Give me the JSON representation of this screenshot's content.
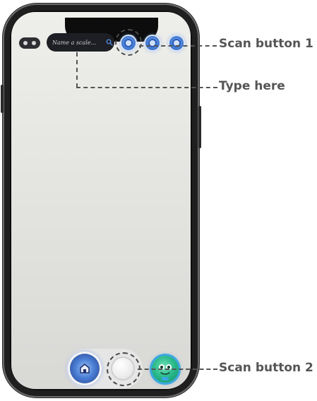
{
  "screen": {
    "search": {
      "placeholder": "Name a scale..."
    }
  },
  "callouts": {
    "scan_button_1": "Scan button 1",
    "type_here": "Type here",
    "scan_button_2": "Scan button 2"
  },
  "icons": {
    "search": "search-icon",
    "home": "home-icon",
    "mascot": "mascot-icon"
  },
  "colors": {
    "accent_blue": "#4f86da",
    "callout_gray": "#555555",
    "mascot_green": "#27b889"
  }
}
